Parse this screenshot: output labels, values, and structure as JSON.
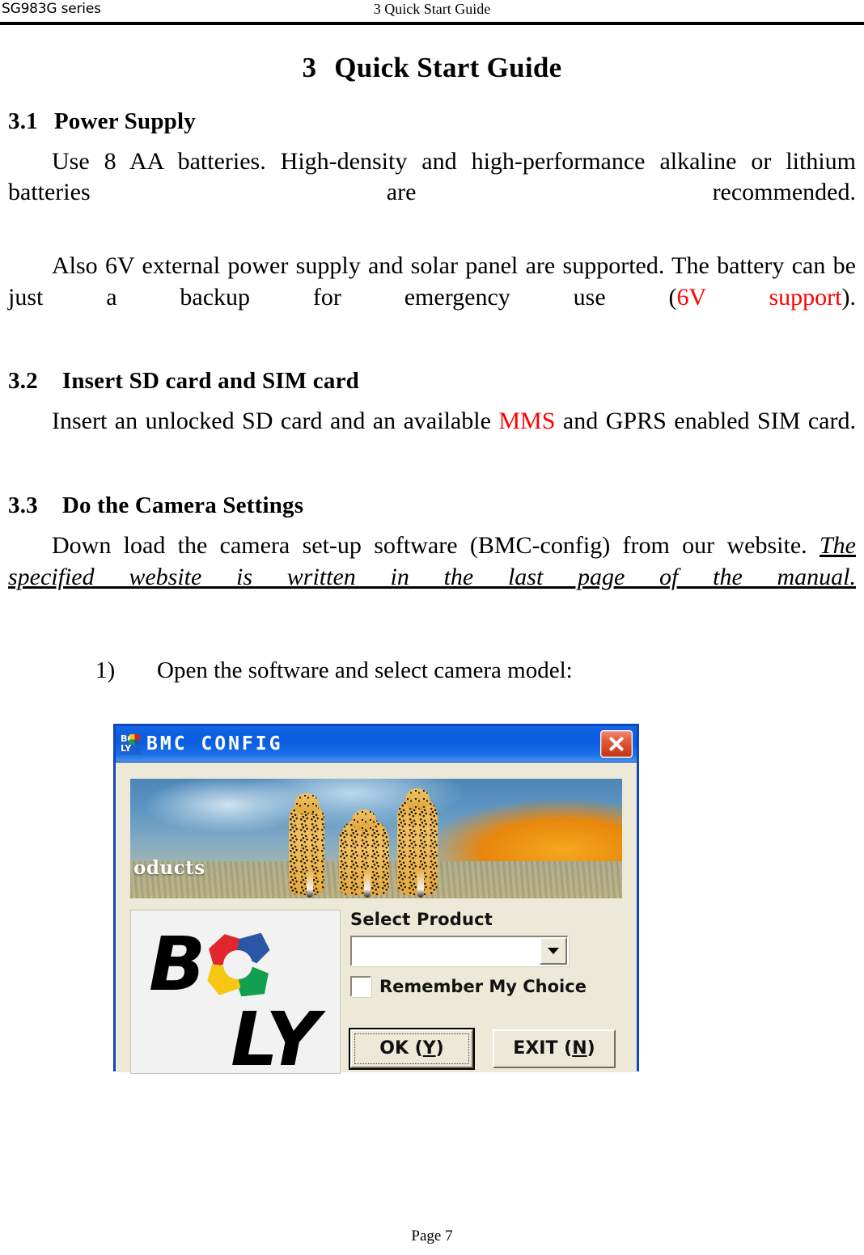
{
  "header": {
    "left": "SG983G series",
    "right": "3 Quick Start Guide"
  },
  "title": {
    "number": "3",
    "text": "Quick Start Guide"
  },
  "sections": [
    {
      "number": "3.1",
      "heading": "Power Supply",
      "paragraphs": [
        {
          "run1": "Use 8 AA batteries. High-density and high-performance alkaline or lithium batteries are recommended."
        },
        {
          "run1": "Also 6V external power supply and solar panel are supported. The battery can be just a backup for emergency use (",
          "red": "6V support",
          "run2": ")."
        }
      ]
    },
    {
      "number": "3.2",
      "heading": "Insert SD card and SIM card",
      "paragraphs": [
        {
          "run1": "Insert an unlocked SD card and an available ",
          "red": "MMS",
          "run2": " and GPRS enabled SIM card."
        }
      ]
    },
    {
      "number": "3.3",
      "heading": "Do the Camera Settings",
      "paragraphs": [
        {
          "run1": "Down load the camera set-up software (BMC-config) from our website. ",
          "italic_underline": "The specified website is written in the last page of the manual."
        }
      ]
    }
  ],
  "list": {
    "items": [
      {
        "marker": "1)",
        "text": "Open the software and select camera model:"
      }
    ]
  },
  "dialog": {
    "window_title": "BMC CONFIG",
    "app_icon": "boly-logo-icon",
    "icon_line1": "BO",
    "icon_line2": "LY",
    "close_label": "close-icon",
    "banner": {
      "caption": "oducts",
      "alt": "three cheetahs walking on savanna"
    },
    "logo": {
      "letter_b": "B",
      "letters_ly": "LY"
    },
    "select_product_label": "Select Product",
    "select_product_value": "",
    "select_product_placeholder": "",
    "remember_checkbox": {
      "label": "Remember My Choice",
      "checked": false
    },
    "buttons": [
      {
        "prefix": "OK (",
        "key": "Y",
        "suffix": ")",
        "default": true
      },
      {
        "prefix": "EXIT (",
        "key": "N",
        "suffix": ")",
        "default": false
      }
    ]
  },
  "footer": {
    "page": "Page 7"
  },
  "colors": {
    "accent_red": "#ff0000",
    "titlebar_blue": "#0a5ce0",
    "dialog_face": "#ece9d8",
    "close_red": "#c33412"
  }
}
